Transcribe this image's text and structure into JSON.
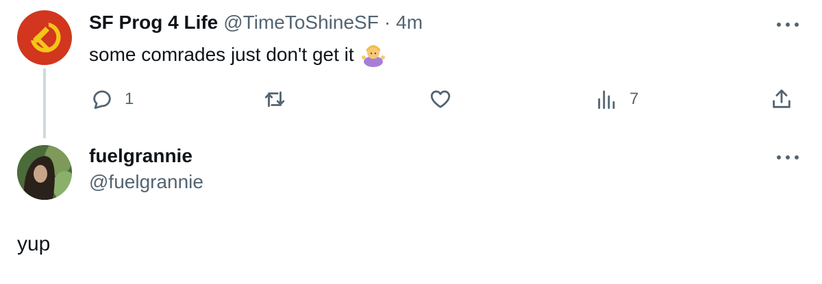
{
  "tweet": {
    "display_name": "SF Prog 4 Life",
    "handle": "@TimeToShineSF",
    "separator": "·",
    "time": "4m",
    "text": "some comrades just don't get it",
    "emoji_icon": "person-shrugging-emoji",
    "actions": {
      "reply_count": "1",
      "views_count": "7"
    }
  },
  "reply": {
    "display_name": "fuelgrannie",
    "handle": "@fuelgrannie",
    "text": "yup"
  },
  "colors": {
    "text_primary": "#0f1419",
    "text_secondary": "#536471",
    "thread_line": "#cfd9de",
    "avatar1_bg": "#d2361e",
    "avatar1_symbol": "#f5c518"
  }
}
